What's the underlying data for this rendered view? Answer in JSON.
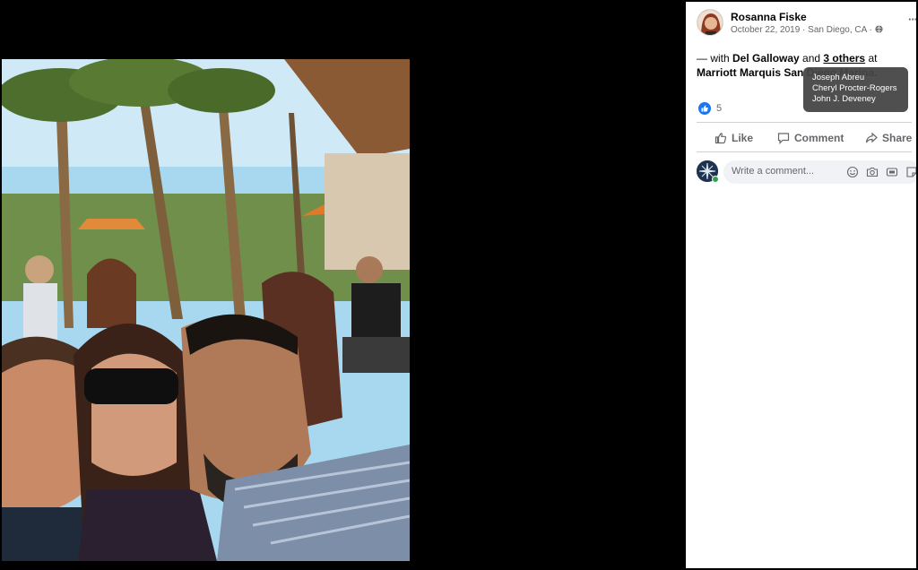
{
  "post": {
    "author": "Rosanna Fiske",
    "date": "October 22, 2019",
    "separator": " · ",
    "location": "San Diego, CA",
    "separator2": " · ",
    "more_label": "···",
    "privacy_icon": "globe-icon"
  },
  "caption": {
    "prefix": "— with ",
    "tagged": "Del Galloway",
    "and": " and ",
    "others_link": "3 others",
    "at": " at ",
    "place": "Marriott Marquis San Diego Marina."
  },
  "tooltip": {
    "names": [
      "Joseph Abreu",
      "Cheryl Procter-Rogers",
      "John J. Deveney"
    ]
  },
  "reactions": {
    "count": "5",
    "icon": "like-icon"
  },
  "actions": {
    "like": "Like",
    "comment": "Comment",
    "share": "Share"
  },
  "comment_box": {
    "placeholder": "Write a comment...",
    "icons": [
      "emoji-icon",
      "camera-icon",
      "gif-icon",
      "sticker-icon"
    ]
  },
  "colors": {
    "brand_blue": "#1877f2",
    "online_green": "#31a24c",
    "muted_text": "#65676b",
    "input_bg": "#f0f2f5"
  }
}
